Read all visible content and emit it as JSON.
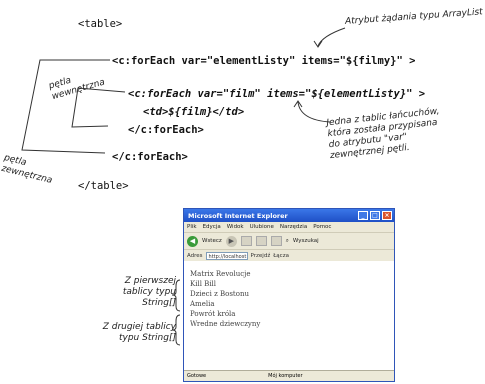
{
  "code": {
    "line1": "<table>",
    "line2": "<c:forEach var=\"elementListy\" items=\"${filmy}\" >",
    "line3": "<c:forEach var=\"film\" items=\"${elementListy}\" >",
    "line4": "<td>${film}</td>",
    "line5": "</c:forEach>",
    "line6": "</c:forEach>",
    "line7": "</table>"
  },
  "annotations": {
    "arraylist": "Atrybut żądania typu ArrayList",
    "inner_loop": "pętla wewnętrzna",
    "outer_loop": "pętla zewnętrzna",
    "one_table": "Jedna z tablic łańcuchów, która została przypisana do atrybutu \"var\" zewnętrznej pętli.",
    "first_array": "Z pierwszej tablicy typu String[]",
    "second_array": "Z drugiej tablicy typu String[]"
  },
  "browser": {
    "title": "Microsoft Internet Explorer",
    "menu": [
      "Plik",
      "Edycja",
      "Widok",
      "Ulubione",
      "Narzędzia",
      "Pomoc"
    ],
    "back": "Wstecz",
    "search": "Wyszukaj",
    "address_label": "Adres",
    "address_value": "http://localhost",
    "go": "Przejdź",
    "links": "Łącza",
    "items": [
      "Matrix Revolucje",
      "Kill Bill",
      "Dzieci z Bostonu",
      "Amelia",
      "Powrót króla",
      "Wredne dziewczyny"
    ],
    "status_left": "Gotowe",
    "status_right": "Mój komputer"
  }
}
